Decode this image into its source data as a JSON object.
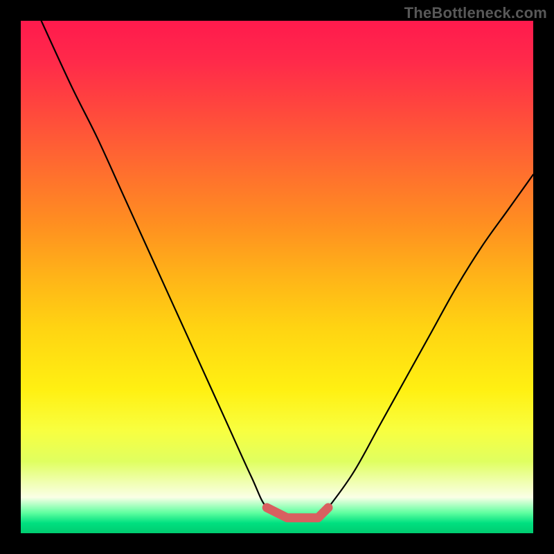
{
  "watermark": "TheBottleneck.com",
  "colors": {
    "background": "#000000",
    "curve": "#000000",
    "bottom_marker": "#d86060"
  },
  "chart_data": {
    "type": "line",
    "title": "",
    "xlabel": "",
    "ylabel": "",
    "xlim": [
      0,
      100
    ],
    "ylim": [
      0,
      100
    ],
    "grid": false,
    "legend": false,
    "series": [
      {
        "name": "bottleneck-curve",
        "x": [
          4,
          10,
          15,
          20,
          25,
          30,
          35,
          40,
          45,
          48,
          52,
          55,
          58,
          60,
          65,
          70,
          75,
          80,
          85,
          90,
          95,
          100
        ],
        "values": [
          100,
          87,
          77,
          66,
          55,
          44,
          33,
          22,
          11,
          5,
          3,
          3,
          3,
          5,
          12,
          21,
          30,
          39,
          48,
          56,
          63,
          70
        ]
      }
    ],
    "annotations": [
      {
        "name": "minimum-band",
        "x_start": 48,
        "x_end": 60,
        "y": 3
      }
    ]
  }
}
